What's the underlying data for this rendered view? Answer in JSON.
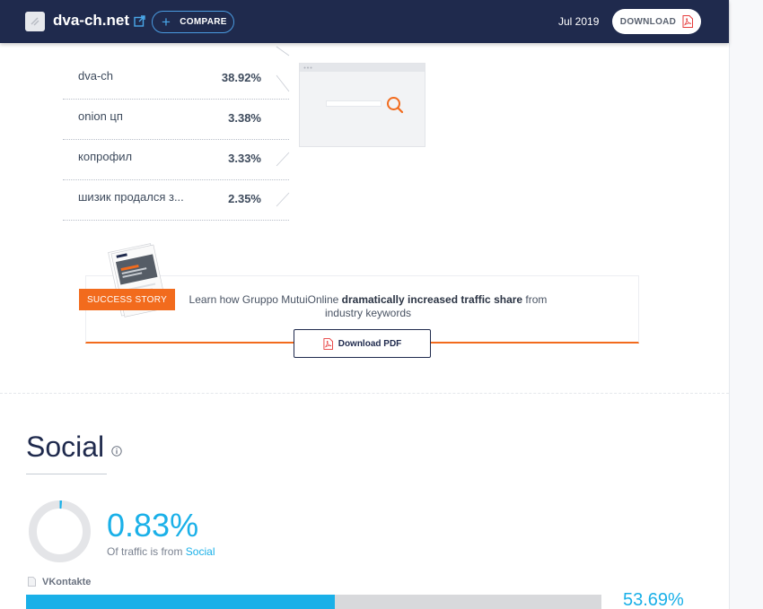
{
  "header": {
    "site_name": "dva-ch.net",
    "compare_label": "COMPARE",
    "date": "Jul 2019",
    "download_label": "DOWNLOAD"
  },
  "keywords": [
    {
      "name": "dva-ch",
      "share": "38.92%"
    },
    {
      "name": "onion цп",
      "share": "3.38%"
    },
    {
      "name": "копрофил",
      "share": "3.33%"
    },
    {
      "name": "шизик продался з...",
      "share": "2.35%"
    }
  ],
  "banner": {
    "tag": "SUCCESS STORY",
    "text_before": "Learn how Gruppo MutuiOnline ",
    "text_bold": "dramatically increased traffic share",
    "text_after": " from industry keywords",
    "pdf_label": "Download PDF"
  },
  "social": {
    "title": "Social",
    "percent": "0.83%",
    "percent_value": 0.0083,
    "sub_prefix": "Of traffic is from ",
    "sub_link": "Social",
    "sources": [
      {
        "name": "VKontakte",
        "percent": "53.69%",
        "value": 0.5369
      }
    ]
  },
  "colors": {
    "header_bg": "#1f2a4d",
    "accent_blue": "#1ab0e8",
    "accent_orange": "#f26b1d",
    "pdf_red": "#e63b3b"
  }
}
